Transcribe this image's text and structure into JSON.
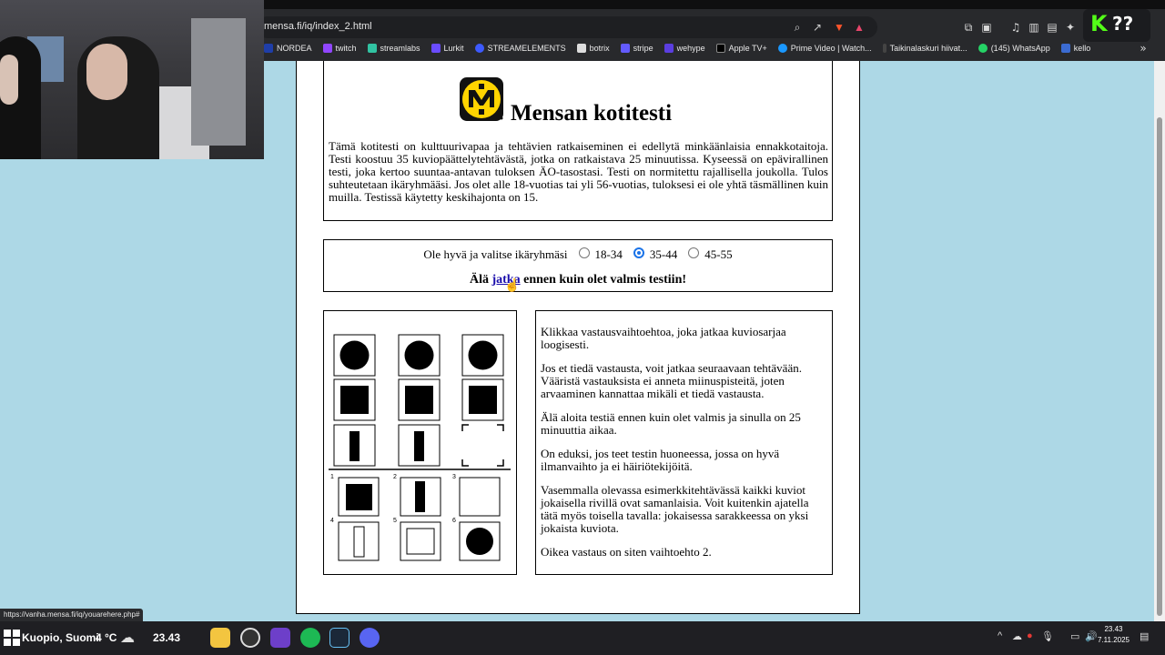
{
  "browser": {
    "url": "mensa.fi/iq/index_2.html",
    "bookmarks": [
      "NORDEA",
      "twitch",
      "streamlabs",
      "Lurkit",
      "STREAMELEMENTS",
      "botrix",
      "stripe",
      "wehype",
      "Apple TV+",
      "Prime Video | Watch...",
      "Taikinalaskuri hiivat...",
      "(145) WhatsApp",
      "kello"
    ],
    "bookmarks_more": "»",
    "kick_overlay": "K ??"
  },
  "intro": {
    "title": "Mensan kotitesti",
    "text": "Tämä kotitesti on kulttuurivapaa ja tehtävien ratkaiseminen ei edellytä minkäänlaisia ennakkotaitoja. Testi koostuu 35 kuviopäättelytehtävästä, jotka on ratkaistava 25 minuutissa. Kyseessä on epävirallinen testi, joka kertoo suuntaa-antavan tuloksen ÄO-tasostasi. Testi on normitettu rajallisella joukolla. Tulos suhteutetaan ikäryhmääsi. Jos olet alle 18-vuotias tai yli 56-vuotias, tuloksesi ei ole yhtä täsmällinen kuin muilla. Testissä käytetty keskihajonta on 15."
  },
  "age": {
    "prompt": "Ole hyvä ja valitse ikäryhmäsi",
    "options": [
      "18-34",
      "35-44",
      "45-55"
    ],
    "selected": "35-44",
    "warn_before": "Älä",
    "continue_link": "jatka",
    "warn_after": "ennen kuin olet valmis testiin!"
  },
  "puzzle": {
    "option_numbers": [
      "1",
      "2",
      "3",
      "4",
      "5",
      "6"
    ]
  },
  "instructions": [
    "Klikkaa vastausvaihtoehtoa, joka jatkaa kuviosarjaa loogisesti.",
    "Jos et tiedä vastausta, voit jatkaa seuraavaan tehtävään. Vääristä vastauksista ei anneta miinuspisteitä, joten arvaaminen kannattaa mikäli et tiedä vastausta.",
    "Älä aloita testiä ennen kuin olet valmis ja sinulla on 25 minuuttia aikaa.",
    "On eduksi, jos teet testin huoneessa, jossa on hyvä ilmanvaihto ja ei häiriötekijöitä.",
    "Vasemmalla olevassa esimerkkitehtävässä kaikki kuviot jokaisella rivillä ovat samanlaisia. Voit kuitenkin ajatella tätä myös toisella tavalla: jokaisessa sarakkeessa on yksi jokaista kuviota.",
    "Oikea vastaus on siten vaihtoehto 2."
  ],
  "status_url": "https://vanha.mensa.fi/iq/youarehere.php#",
  "taskbar": {
    "weather_location": "Kuopio, Suomi",
    "temperature": "4 °C",
    "time_left": "23.43",
    "clock_time": "23.43",
    "clock_date": "7.11.2025"
  }
}
